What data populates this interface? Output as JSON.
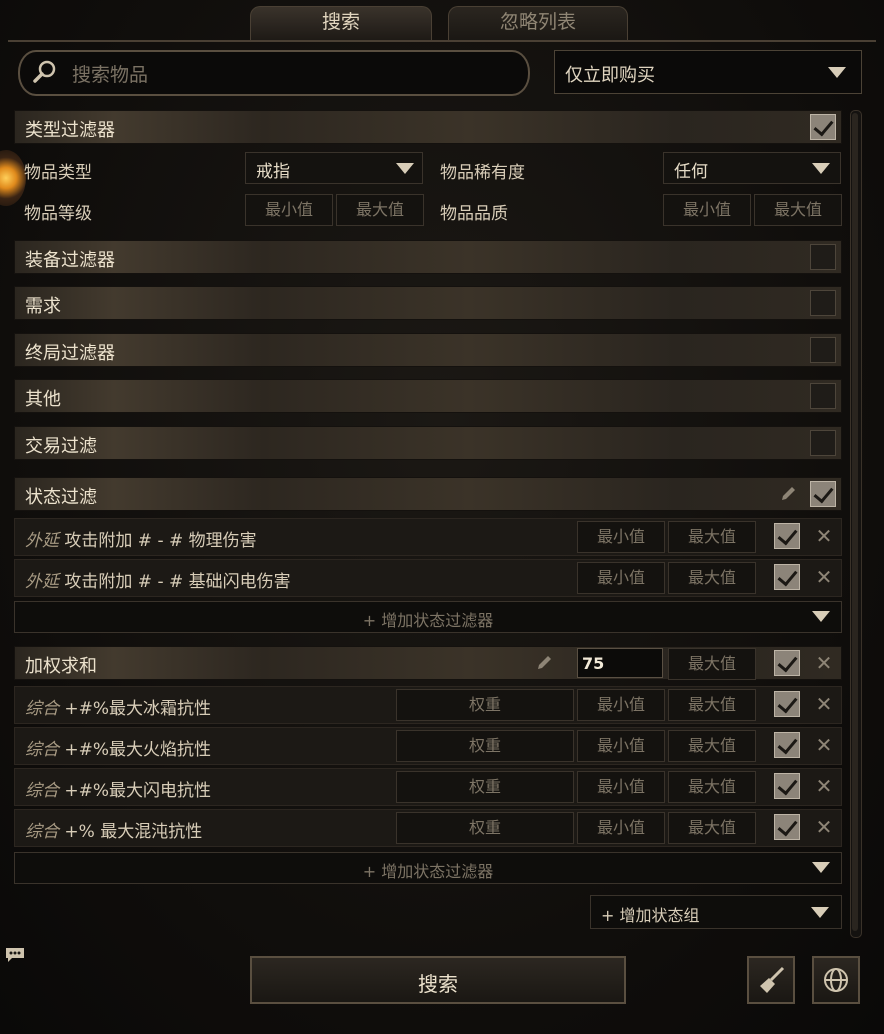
{
  "tabs": {
    "search": "搜索",
    "ignore_list": "忽略列表"
  },
  "search": {
    "placeholder": "搜索物品",
    "buy_mode": "仅立即购买"
  },
  "type_filter": {
    "title": "类型过滤器",
    "checked": true,
    "item_type_label": "物品类型",
    "item_type_value": "戒指",
    "rarity_label": "物品稀有度",
    "rarity_value": "任何",
    "level_label": "物品等级",
    "quality_label": "物品品质",
    "min": "最小值",
    "max": "最大值"
  },
  "collapsed_filters": [
    {
      "title": "装备过滤器",
      "checked": false
    },
    {
      "title": "需求",
      "checked": false
    },
    {
      "title": "终局过滤器",
      "checked": false
    },
    {
      "title": "其他",
      "checked": false
    },
    {
      "title": "交易过滤",
      "checked": false
    }
  ],
  "stat_filters": {
    "title": "状态过滤",
    "checked": true,
    "rows": [
      {
        "prefix": "外延",
        "text": "攻击附加 # - # 物理伤害",
        "min": "最小值",
        "max": "最大值",
        "checked": true
      },
      {
        "prefix": "外延",
        "text": "攻击附加 # - # 基础闪电伤害",
        "min": "最小值",
        "max": "最大值",
        "checked": true
      }
    ],
    "add_label": "+ 增加状态过滤器"
  },
  "weighted_sum": {
    "title": "加权求和",
    "min_value": "75",
    "max": "最大值",
    "checked": true,
    "rows": [
      {
        "prefix": "综合",
        "text": "+#%最大冰霜抗性",
        "weight": "权重",
        "min": "最小值",
        "max": "最大值",
        "checked": true
      },
      {
        "prefix": "综合",
        "text": "+#%最大火焰抗性",
        "weight": "权重",
        "min": "最小值",
        "max": "最大值",
        "checked": true
      },
      {
        "prefix": "综合",
        "text": "+#%最大闪电抗性",
        "weight": "权重",
        "min": "最小值",
        "max": "最大值",
        "checked": true
      },
      {
        "prefix": "综合",
        "text": "+% 最大混沌抗性",
        "weight": "权重",
        "min": "最小值",
        "max": "最大值",
        "checked": true
      }
    ],
    "add_label": "+ 增加状态过滤器"
  },
  "add_group_label": "+ 增加状态组",
  "search_button": "搜索",
  "icons": {
    "clear": "broom-icon",
    "language": "globe-icon",
    "search": "magnifier-icon"
  },
  "colors": {
    "accent": "#d8cdb8",
    "checkbox_on": "#8c8479",
    "background": "#0e0c0a"
  }
}
